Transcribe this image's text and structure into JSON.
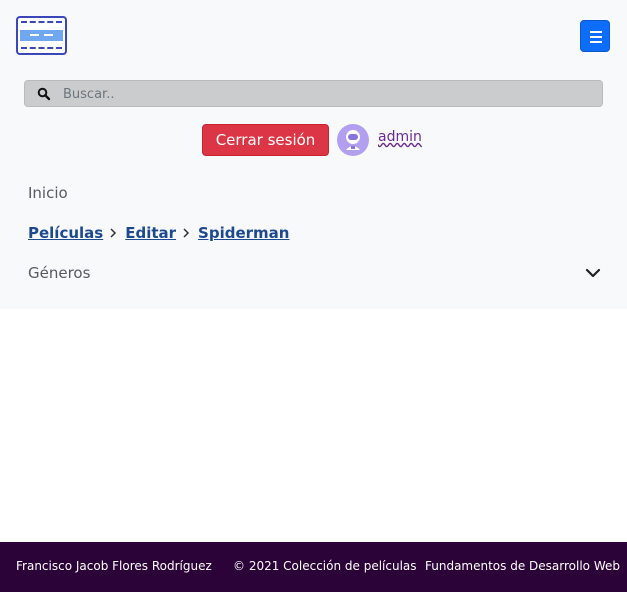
{
  "header": {
    "logo_icon": "film-strip-icon",
    "menu_icon": "hamburger-menu-icon"
  },
  "search": {
    "placeholder": "Buscar..",
    "value": "",
    "icon": "search-icon"
  },
  "user": {
    "logout_label": "Cerrar sesión",
    "avatar_icon": "user-avatar-icon",
    "username": "admin"
  },
  "nav": {
    "inicio": "Inicio",
    "breadcrumb": [
      "Películas",
      "Editar",
      "Spiderman"
    ],
    "generos": "Géneros",
    "generos_icon": "chevron-down-icon"
  },
  "footer": {
    "author": "Francisco Jacob Flores Rodríguez",
    "copyright": "© 2021 Colección de películas",
    "course": "Fundamentos de Desarrollo Web"
  },
  "colors": {
    "navbar_bg": "#f8f9fa",
    "logout_bg": "#dc3545",
    "menu_button_bg": "#0d6efd",
    "footer_bg": "#2c0338",
    "breadcrumb_link": "#1d4a8f"
  }
}
